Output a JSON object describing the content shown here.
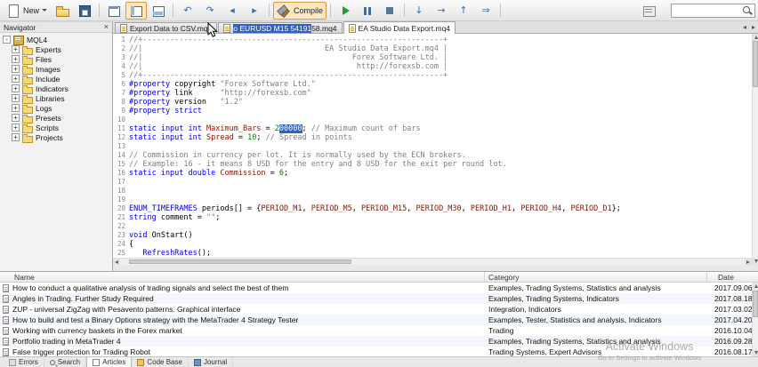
{
  "toolbar": {
    "new_label": "New",
    "compile_label": "Compile",
    "search_value": ""
  },
  "icons": {
    "new_file": "page",
    "open": "folder",
    "save": "floppy",
    "new_window": "window",
    "navigator_toggle": "panel-left",
    "toolbox_toggle": "panel-bottom",
    "undo": "↶",
    "redo": "↷",
    "back": "◂",
    "forward": "▸",
    "compile": "hammer",
    "start": "play-triangle",
    "pause": "pause-bars",
    "stop": "stop-square",
    "step_into": "↓",
    "step_over": "→",
    "step_out": "↑",
    "continue": "⇒",
    "search": "magnifier",
    "close": "×"
  },
  "tabs": [
    {
      "label": "Export Data to CSV.mq4"
    },
    {
      "label": "o EURUSD M15 5419158.mq4",
      "sel_len": 18
    },
    {
      "label": "EA Studio Data Export.mq4",
      "active": true
    }
  ],
  "navigator": {
    "title": "Navigator",
    "items": [
      {
        "label": "MQL4",
        "root": true,
        "exp": "-",
        "icon": "mql4"
      },
      {
        "label": "Experts",
        "exp": "+",
        "icon": "folder"
      },
      {
        "label": "Files",
        "exp": "+",
        "icon": "folder"
      },
      {
        "label": "Images",
        "exp": "+",
        "icon": "folder"
      },
      {
        "label": "Include",
        "exp": "+",
        "icon": "folder"
      },
      {
        "label": "Indicators",
        "exp": "+",
        "icon": "folder"
      },
      {
        "label": "Libraries",
        "exp": "+",
        "icon": "folder"
      },
      {
        "label": "Logs",
        "exp": "+",
        "icon": "folder"
      },
      {
        "label": "Presets",
        "exp": "+",
        "icon": "folder"
      },
      {
        "label": "Scripts",
        "exp": "+",
        "icon": "folder"
      },
      {
        "label": "Projects",
        "exp": "+",
        "icon": "folder"
      }
    ]
  },
  "editor": {
    "lines": [
      {
        "n": 1,
        "s": [
          [
            "com",
            "//+------------------------------------------------------------------+"
          ]
        ]
      },
      {
        "n": 2,
        "s": [
          [
            "com",
            "//|                                        EA Studio Data Export.mq4 |"
          ]
        ]
      },
      {
        "n": 3,
        "s": [
          [
            "com",
            "//|                                              Forex Software Ltd. |"
          ]
        ]
      },
      {
        "n": 4,
        "s": [
          [
            "com",
            "//|                                               http://forexsb.com |"
          ]
        ]
      },
      {
        "n": 5,
        "s": [
          [
            "com",
            "//+------------------------------------------------------------------+"
          ]
        ]
      },
      {
        "n": 6,
        "s": [
          [
            "kw",
            "#property"
          ],
          [
            "pl",
            " copyright "
          ],
          [
            "str",
            "\"Forex Software Ltd.\""
          ]
        ]
      },
      {
        "n": 7,
        "s": [
          [
            "kw",
            "#property"
          ],
          [
            "pl",
            " link      "
          ],
          [
            "str",
            "\"http://forexsb.com\""
          ]
        ]
      },
      {
        "n": 8,
        "s": [
          [
            "kw",
            "#property"
          ],
          [
            "pl",
            " version   "
          ],
          [
            "str",
            "\"1.2\""
          ]
        ]
      },
      {
        "n": 9,
        "s": [
          [
            "kw",
            "#property"
          ],
          [
            "pl",
            " "
          ],
          [
            "kw",
            "strict"
          ]
        ]
      },
      {
        "n": 10,
        "s": []
      },
      {
        "n": 11,
        "s": [
          [
            "kw",
            "static input int"
          ],
          [
            "pl",
            " "
          ],
          [
            "id",
            "Maximum_Bars"
          ],
          [
            "pl",
            " = "
          ],
          [
            "num",
            "2"
          ],
          [
            "sel",
            "00000"
          ],
          [
            "pl",
            "; "
          ],
          [
            "com",
            "// Maximum count of bars"
          ]
        ]
      },
      {
        "n": 12,
        "s": [
          [
            "kw",
            "static input int"
          ],
          [
            "pl",
            " "
          ],
          [
            "id",
            "Spread"
          ],
          [
            "pl",
            " = "
          ],
          [
            "num",
            "10"
          ],
          [
            "pl",
            "; "
          ],
          [
            "com",
            "// Spread in points"
          ]
        ]
      },
      {
        "n": 13,
        "s": []
      },
      {
        "n": 14,
        "s": [
          [
            "com",
            "// Commission in currency per lot. It is normally used by the ECN brokers."
          ]
        ]
      },
      {
        "n": 15,
        "s": [
          [
            "com",
            "// Example: 16 - it means 8 USD for the entry and 8 USD for the exit per round lot."
          ]
        ]
      },
      {
        "n": 16,
        "s": [
          [
            "kw",
            "static input double"
          ],
          [
            "pl",
            " "
          ],
          [
            "id",
            "Commission"
          ],
          [
            "pl",
            " = "
          ],
          [
            "num",
            "6"
          ],
          [
            "pl",
            ";"
          ]
        ]
      },
      {
        "n": 17,
        "s": []
      },
      {
        "n": 18,
        "s": []
      },
      {
        "n": 19,
        "s": []
      },
      {
        "n": 20,
        "s": [
          [
            "kw",
            "ENUM_TIMEFRAMES"
          ],
          [
            "pl",
            " periods[] = {"
          ],
          [
            "id",
            "PERIOD_M1"
          ],
          [
            "pl",
            ", "
          ],
          [
            "id",
            "PERIOD_M5"
          ],
          [
            "pl",
            ", "
          ],
          [
            "id",
            "PERIOD_M15"
          ],
          [
            "pl",
            ", "
          ],
          [
            "id",
            "PERIOD_M30"
          ],
          [
            "pl",
            ", "
          ],
          [
            "id",
            "PERIOD_H1"
          ],
          [
            "pl",
            ", "
          ],
          [
            "id",
            "PERIOD_H4"
          ],
          [
            "pl",
            ", "
          ],
          [
            "id",
            "PERIOD_D1"
          ],
          [
            "pl",
            "};"
          ]
        ]
      },
      {
        "n": 21,
        "s": [
          [
            "kw",
            "string"
          ],
          [
            "pl",
            " comment = "
          ],
          [
            "str",
            "\"\""
          ],
          [
            "pl",
            ";"
          ]
        ]
      },
      {
        "n": 22,
        "s": []
      },
      {
        "n": 23,
        "s": [
          [
            "kw",
            "void"
          ],
          [
            "pl",
            " OnStart()"
          ]
        ]
      },
      {
        "n": 24,
        "s": [
          [
            "pl",
            "{"
          ]
        ]
      },
      {
        "n": 25,
        "s": [
          [
            "pl",
            "   "
          ],
          [
            "fn",
            "RefreshRates"
          ],
          [
            "pl",
            "();"
          ]
        ]
      }
    ]
  },
  "toolbox": {
    "columns": [
      "Name",
      "Category",
      "Date"
    ],
    "rows": [
      {
        "name": "How to conduct a qualitative analysis of trading signals and select the best of them",
        "category": "Examples, Trading Systems, Statistics and analysis",
        "date": "2017.09.06"
      },
      {
        "name": "Angles in Trading. Further Study Required",
        "category": "Examples, Trading Systems, Indicators",
        "date": "2017.08.18"
      },
      {
        "name": "ZUP - universal ZigZag with Pesavento patterns. Graphical interface",
        "category": "Integration, Indicators",
        "date": "2017.03.02"
      },
      {
        "name": "How to build and test a Binary Options strategy with the MetaTrader 4 Strategy Tester",
        "category": "Examples, Tester, Statistics and analysis, Indicators",
        "date": "2017.04.20"
      },
      {
        "name": "Working with currency baskets in the Forex market",
        "category": "Trading",
        "date": "2016.10.04"
      },
      {
        "name": "Portfolio trading in MetaTrader 4",
        "category": "Examples, Trading Systems, Statistics and analysis",
        "date": "2016.09.28"
      },
      {
        "name": "False trigger protection for Trading Robot",
        "category": "Trading Systems, Expert Advisors",
        "date": "2016.08.17"
      }
    ],
    "tabs": [
      {
        "label": "Errors",
        "icon": "errors"
      },
      {
        "label": "Search",
        "icon": "search"
      },
      {
        "label": "Articles",
        "icon": "articles"
      },
      {
        "label": "Code Base",
        "icon": "codebase"
      },
      {
        "label": "Journal",
        "icon": "journal"
      }
    ],
    "active_tab": "Articles"
  },
  "watermark": {
    "line1": "Activate Windows",
    "line2": "Go to Settings to activate Windows"
  }
}
